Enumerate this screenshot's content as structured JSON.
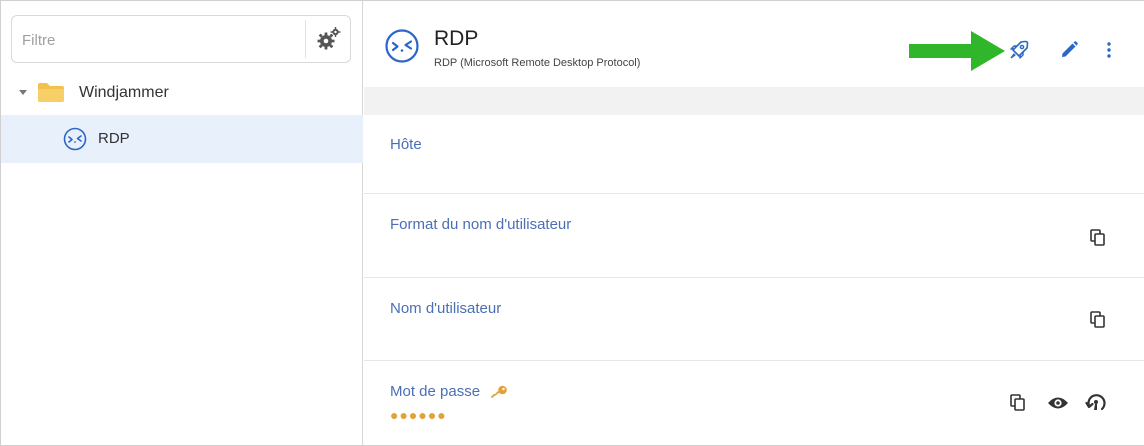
{
  "sidebar": {
    "filter_placeholder": "Filtre",
    "folder_label": "Windjammer",
    "entry_label": "RDP"
  },
  "header": {
    "title": "RDP",
    "subtitle": "RDP (Microsoft Remote Desktop Protocol)"
  },
  "fields": {
    "host_label": "Hôte",
    "host_value": "",
    "format_label": "Format du nom d'utilisateur",
    "format_value": "",
    "username_label": "Nom d'utilisateur",
    "username_value": "",
    "password_label": "Mot de passe",
    "password_masked": "●●●●●●"
  },
  "icons": {
    "filter_settings": "gears-icon",
    "folder": "folder-icon",
    "entry": "rdp-icon",
    "launch": "rocket-icon",
    "edit": "pencil-icon",
    "more": "more-vertical-icon",
    "copy": "copy-icon",
    "show": "eye-icon",
    "password_tool": "password-refresh-icon",
    "key": "key-icon",
    "annotation": "green-arrow"
  },
  "colors": {
    "accent": "#2a66c9",
    "label": "#4a6fb5",
    "selected_row": "#e8f0fb",
    "folder": "#f2c14e",
    "arrow": "#2fb62b",
    "key": "#e3a13a"
  }
}
